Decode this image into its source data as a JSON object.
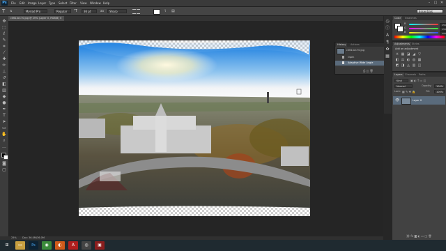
{
  "app": {
    "logo": "Ps",
    "menu": [
      "File",
      "Edit",
      "Image",
      "Layer",
      "Type",
      "Select",
      "Filter",
      "View",
      "Window",
      "Help"
    ],
    "window_controls": [
      "–",
      "□",
      "✕"
    ]
  },
  "options_bar": {
    "font_family": "Myriad Pro",
    "font_style": "Regular",
    "font_size": "36 pt",
    "anti_alias": "Sharp",
    "workspace": "Essentials"
  },
  "document": {
    "tab_label": "c0614c170.jpg @ 25% (Layer 0, RGB/8) ✕"
  },
  "history_panel": {
    "tabs": [
      "History",
      "Actions"
    ],
    "snapshot": "c0614c170.jpg",
    "items": [
      "Open",
      "Adaptive Wide Angle"
    ]
  },
  "color_panel": {
    "tabs": [
      "Color",
      "Swatches"
    ],
    "sliders": [
      {
        "label": "R",
        "value": "255",
        "color": "#d85a5a"
      },
      {
        "label": "G",
        "value": "255",
        "color": "#5ad85a"
      },
      {
        "label": "B",
        "value": "255",
        "color": "#5a6ad8"
      }
    ]
  },
  "adjustments_panel": {
    "tabs": [
      "Adjustments",
      "Styles"
    ],
    "title": "Add an adjustment",
    "row1": [
      "☀",
      "▦",
      "◪",
      "◢",
      "▽"
    ],
    "row2": [
      "◧",
      "⚖",
      "◐",
      "◍",
      "▦"
    ],
    "row3": [
      "◩",
      "◨",
      "◬",
      "▥",
      "◫"
    ]
  },
  "layers_panel": {
    "tabs": [
      "Layers",
      "Channels",
      "Paths"
    ],
    "kind": "Kind",
    "blend_mode": "Normal",
    "opacity_label": "Opacity:",
    "opacity": "100%",
    "lock_label": "Lock:",
    "fill_label": "Fill:",
    "fill": "100%",
    "layers": [
      {
        "name": "Layer 0",
        "visible": true
      }
    ]
  },
  "status": {
    "zoom": "25%",
    "doc_size": "Doc: 36.0M/36.0M"
  },
  "taskbar": {
    "apps": [
      {
        "name": "start",
        "glyph": "⊞",
        "color": "#1f2a30"
      },
      {
        "name": "explorer",
        "glyph": "▭",
        "color": "#c8a040"
      },
      {
        "name": "photoshop",
        "glyph": "Ps",
        "color": "#0d2233"
      },
      {
        "name": "chrome",
        "glyph": "◉",
        "color": "#3b8a3b"
      },
      {
        "name": "firefox",
        "glyph": "◐",
        "color": "#d05a1a"
      },
      {
        "name": "acrobat",
        "glyph": "A",
        "color": "#b01e1e"
      },
      {
        "name": "camera",
        "glyph": "◎",
        "color": "#444444"
      },
      {
        "name": "media",
        "glyph": "▣",
        "color": "#8a1e1e"
      }
    ]
  }
}
